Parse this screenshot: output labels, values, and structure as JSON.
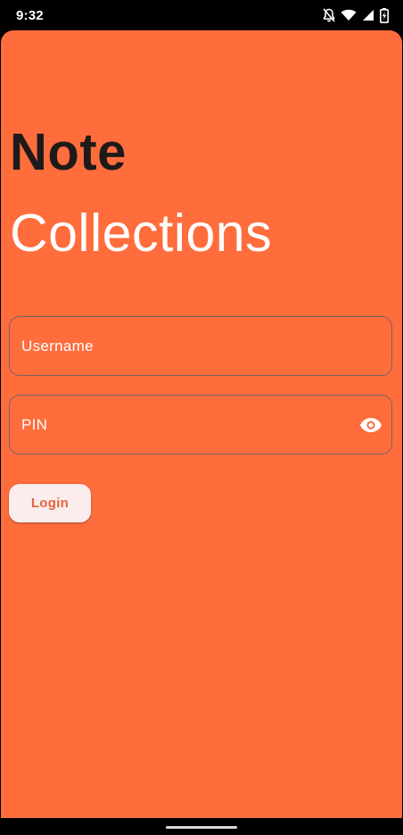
{
  "status_bar": {
    "time": "9:32",
    "icons": [
      "notifications-off-icon",
      "wifi-icon",
      "cellular-signal-icon",
      "battery-charging-icon"
    ]
  },
  "app": {
    "background_color": "#FF6D3D",
    "title_bold": "Note",
    "title_light": "Collections"
  },
  "form": {
    "username": {
      "label": "Username",
      "value": ""
    },
    "pin": {
      "label": "PIN",
      "value": "",
      "toggle_icon": "visibility-icon"
    },
    "login_button": {
      "label": "Login",
      "background_color": "#FBEDEE",
      "text_color": "#E8623A"
    }
  }
}
